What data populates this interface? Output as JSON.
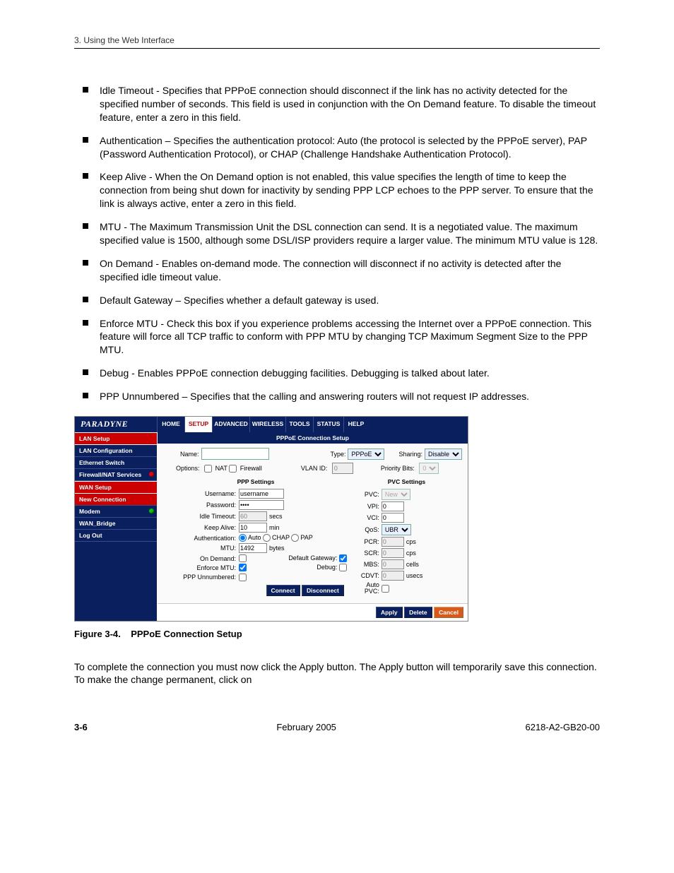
{
  "header": "3. Using the Web Interface",
  "bullets": [
    "Idle Timeout - Specifies that PPPoE connection should disconnect if the link has no activity detected for the specified number of seconds. This field is used in conjunction with the On Demand feature. To disable the timeout feature, enter a zero in this field.",
    "Authentication – Specifies the authentication protocol: Auto (the protocol is selected by the PPPoE server), PAP (Password Authentication Protocol), or CHAP (Challenge Handshake Authentication Protocol).",
    "Keep Alive - When the On Demand option is not enabled, this value specifies the length of time to keep the connection from being shut down for inactivity by sending PPP LCP echoes to the PPP server. To ensure that the link is always active, enter a zero in this field.",
    "MTU - The Maximum Transmission Unit the DSL connection can send. It is a negotiated value. The maximum specified value is 1500, although some DSL/ISP providers require a larger value. The minimum MTU value is 128.",
    "On Demand - Enables on-demand mode. The connection will disconnect if no activity is detected after the specified idle timeout value.",
    "Default Gateway – Specifies whether a default gateway is used.",
    "Enforce MTU - Check this box if you experience problems accessing the Internet over a PPPoE connection. This feature will force all TCP traffic to conform with PPP MTU by changing TCP Maximum Segment Size to the PPP MTU.",
    "Debug - Enables PPPoE connection debugging facilities.  Debugging is talked about later.",
    "PPP Unnumbered – Specifies that the calling and answering routers will not request IP addresses."
  ],
  "figure": {
    "brand": "PARADYNE",
    "tabs": [
      "HOME",
      "SETUP",
      "ADVANCED",
      "WIRELESS",
      "TOOLS",
      "STATUS",
      "HELP"
    ],
    "active_tab": 1,
    "sidebar": {
      "groups": [
        {
          "heading": "LAN Setup",
          "items": [
            {
              "label": "LAN Configuration"
            },
            {
              "label": "Ethernet Switch"
            },
            {
              "label": "Firewall/NAT Services",
              "dot": "r"
            }
          ]
        },
        {
          "heading": "WAN Setup",
          "items": [
            {
              "label": "New Connection",
              "new": true
            },
            {
              "label": "Modem",
              "dot": "g"
            },
            {
              "label": "WAN_Bridge"
            },
            {
              "label": "Log Out"
            }
          ]
        }
      ]
    },
    "content_title": "PPPoE Connection Setup",
    "top": {
      "name_label": "Name:",
      "name_value": "",
      "type_label": "Type:",
      "type_value": "PPPoE",
      "sharing_label": "Sharing:",
      "sharing_value": "Disable",
      "options_label": "Options:",
      "nat_label": "NAT",
      "firewall_label": "Firewall",
      "vlan_label": "VLAN ID:",
      "vlan_value": "0",
      "priority_label": "Priority Bits:",
      "priority_value": "0"
    },
    "ppp": {
      "title": "PPP Settings",
      "username_label": "Username:",
      "username_value": "username",
      "password_label": "Password:",
      "password_value": "****",
      "idle_label": "Idle Timeout:",
      "idle_value": "60",
      "idle_unit": "secs",
      "keep_label": "Keep Alive:",
      "keep_value": "10",
      "keep_unit": "min",
      "auth_label": "Authentication:",
      "auth_auto": "Auto",
      "auth_chap": "CHAP",
      "auth_pap": "PAP",
      "mtu_label": "MTU:",
      "mtu_value": "1492",
      "mtu_unit": "bytes",
      "ondemand_label": "On Demand:",
      "enforce_label": "Enforce MTU:",
      "pppun_label": "PPP Unnumbered:",
      "defgw_label": "Default Gateway:",
      "debug_label": "Debug:",
      "connect": "Connect",
      "disconnect": "Disconnect"
    },
    "pvc": {
      "title": "PVC Settings",
      "pvc_label": "PVC:",
      "pvc_value": "New",
      "vpi_label": "VPI:",
      "vpi_value": "0",
      "vci_label": "VCI:",
      "vci_value": "0",
      "qos_label": "QoS:",
      "qos_value": "UBR",
      "pcr_label": "PCR:",
      "pcr_value": "0",
      "pcr_unit": "cps",
      "scr_label": "SCR:",
      "scr_value": "0",
      "scr_unit": "cps",
      "mbs_label": "MBS:",
      "mbs_value": "0",
      "mbs_unit": "cells",
      "cdvt_label": "CDVT:",
      "cdvt_value": "0",
      "cdvt_unit": "usecs",
      "auto_label": "Auto PVC:"
    },
    "footer_buttons": {
      "apply": "Apply",
      "delete": "Delete",
      "cancel": "Cancel"
    }
  },
  "caption_label": "Figure 3-4.",
  "caption_text": "PPPoE Connection Setup",
  "closing_text": "To complete the connection you must now click the Apply button. The Apply button will temporarily save this connection. To make the change permanent, click on",
  "footer": {
    "page": "3-6",
    "date": "February 2005",
    "doc": "6218-A2-GB20-00"
  }
}
